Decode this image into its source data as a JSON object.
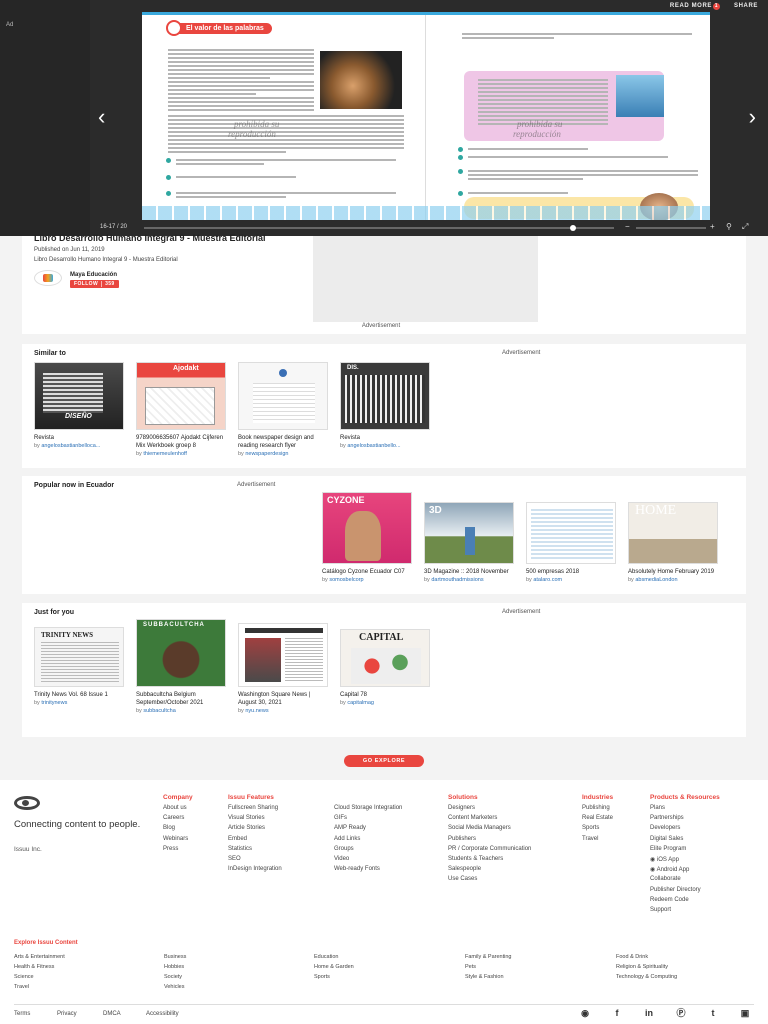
{
  "viewer": {
    "ad_label": "Ad",
    "read_more": "READ MORE",
    "read_more_badge": "1",
    "share": "SHARE",
    "page_count": "16-17 / 20",
    "prev_icon": "chevron-left-icon",
    "next_icon": "chevron-right-icon",
    "chapter_label": "El valor de las palabras",
    "watermark_1": "prohibida su",
    "watermark_2": "reproducción",
    "watermark_3": "prohibida su",
    "watermark_4": "reproducción"
  },
  "info": {
    "title": "Libro Desarrollo Humano Integral 9 - Muestra Editorial",
    "published": "Published on Jun 11, 2019",
    "description": "Libro Desarrollo Humano Integral 9 - Muestra Editorial",
    "author": "Maya Educación",
    "follow_label": "FOLLOW",
    "follow_count": "359",
    "ad_label": "Advertisement"
  },
  "similar": {
    "title": "Similar to",
    "ad_label": "Advertisement",
    "items": [
      {
        "title": "Revista",
        "by": "by",
        "author": "angelosbastianbelloca..."
      },
      {
        "title": "9789006635607 Ajodakt Cijferen Mix Werkboek groep 8",
        "by": "by",
        "author": "thiememeulenhoff"
      },
      {
        "title": "Book newspaper design and reading research flyer",
        "by": "by",
        "author": "newspaperdesign"
      },
      {
        "title": "Revista",
        "by": "by",
        "author": "angelosbastianbello..."
      }
    ]
  },
  "popular": {
    "title": "Popular now in Ecuador",
    "ad_label": "Advertisement",
    "items": [
      {
        "title": "Catálogo Cyzone Ecuador C07",
        "by": "by",
        "author": "somosbelcorp"
      },
      {
        "title": "3D Magazine :: 2018 November",
        "by": "by",
        "author": "dartmouthadmissions"
      },
      {
        "title": "500 empresas 2018",
        "by": "by",
        "author": "atalaro.com"
      },
      {
        "title": "Absolutely Home February 2019",
        "by": "by",
        "author": "absmediaLondon"
      }
    ]
  },
  "just_for_you": {
    "title": "Just for you",
    "ad_label": "Advertisement",
    "items": [
      {
        "title": "Trinity News Vol. 68 Issue 1",
        "by": "by",
        "author": "trinitynews"
      },
      {
        "title": "Subbacultcha Belgium September/October 2021",
        "by": "by",
        "author": "subbacultcha"
      },
      {
        "title": "Washington Square News | August 30, 2021",
        "by": "by",
        "author": "nyu.news"
      },
      {
        "title": "Capital 78",
        "by": "by",
        "author": "capitalmag"
      }
    ]
  },
  "go_explore": "GO EXPLORE",
  "footer": {
    "tagline": "Connecting content to people.",
    "company_name": "Issuu Inc.",
    "columns": [
      {
        "heading": "Company",
        "items": [
          "About us",
          "Careers",
          "Blog",
          "Webinars",
          "Press"
        ]
      },
      {
        "heading": "Issuu Features",
        "items": [
          "Fullscreen Sharing",
          "Visual Stories",
          "Article Stories",
          "Embed",
          "Statistics",
          "SEO",
          "InDesign Integration"
        ]
      },
      {
        "heading": "",
        "items": [
          "Cloud Storage Integration",
          "GIFs",
          "AMP Ready",
          "Add Links",
          "Groups",
          "Video",
          "Web-ready Fonts"
        ]
      },
      {
        "heading": "Solutions",
        "items": [
          "Designers",
          "Content Marketers",
          "Social Media Managers",
          "Publishers",
          "PR / Corporate Communication",
          "Students & Teachers",
          "Salespeople",
          "Use Cases"
        ]
      },
      {
        "heading": "Industries",
        "items": [
          "Publishing",
          "Real Estate",
          "Sports",
          "Travel"
        ]
      },
      {
        "heading": "Products & Resources",
        "items": [
          "Plans",
          "Partnerships",
          "Developers",
          "Digital Sales",
          "Elite Program",
          "iOS App",
          "Android App",
          "Collaborate",
          "Publisher Directory",
          "Redeem Code",
          "Support"
        ]
      }
    ],
    "explore_heading": "Explore Issuu Content",
    "categories": [
      [
        "Arts & Entertainment",
        "Health & Fitness",
        "Science",
        "Travel"
      ],
      [
        "Business",
        "Hobbies",
        "Society",
        "Vehicles"
      ],
      [
        "Education",
        "Home & Garden",
        "Sports"
      ],
      [
        "Family & Parenting",
        "Pets",
        "Style & Fashion"
      ],
      [
        "Food & Drink",
        "Religion & Spirituality",
        "Technology & Computing"
      ]
    ],
    "legal": [
      "Terms",
      "Privacy",
      "DMCA",
      "Accessibility"
    ],
    "social": [
      "issuu-icon",
      "facebook-icon",
      "linkedin-icon",
      "pinterest-icon",
      "twitter-icon",
      "instagram-icon"
    ]
  }
}
